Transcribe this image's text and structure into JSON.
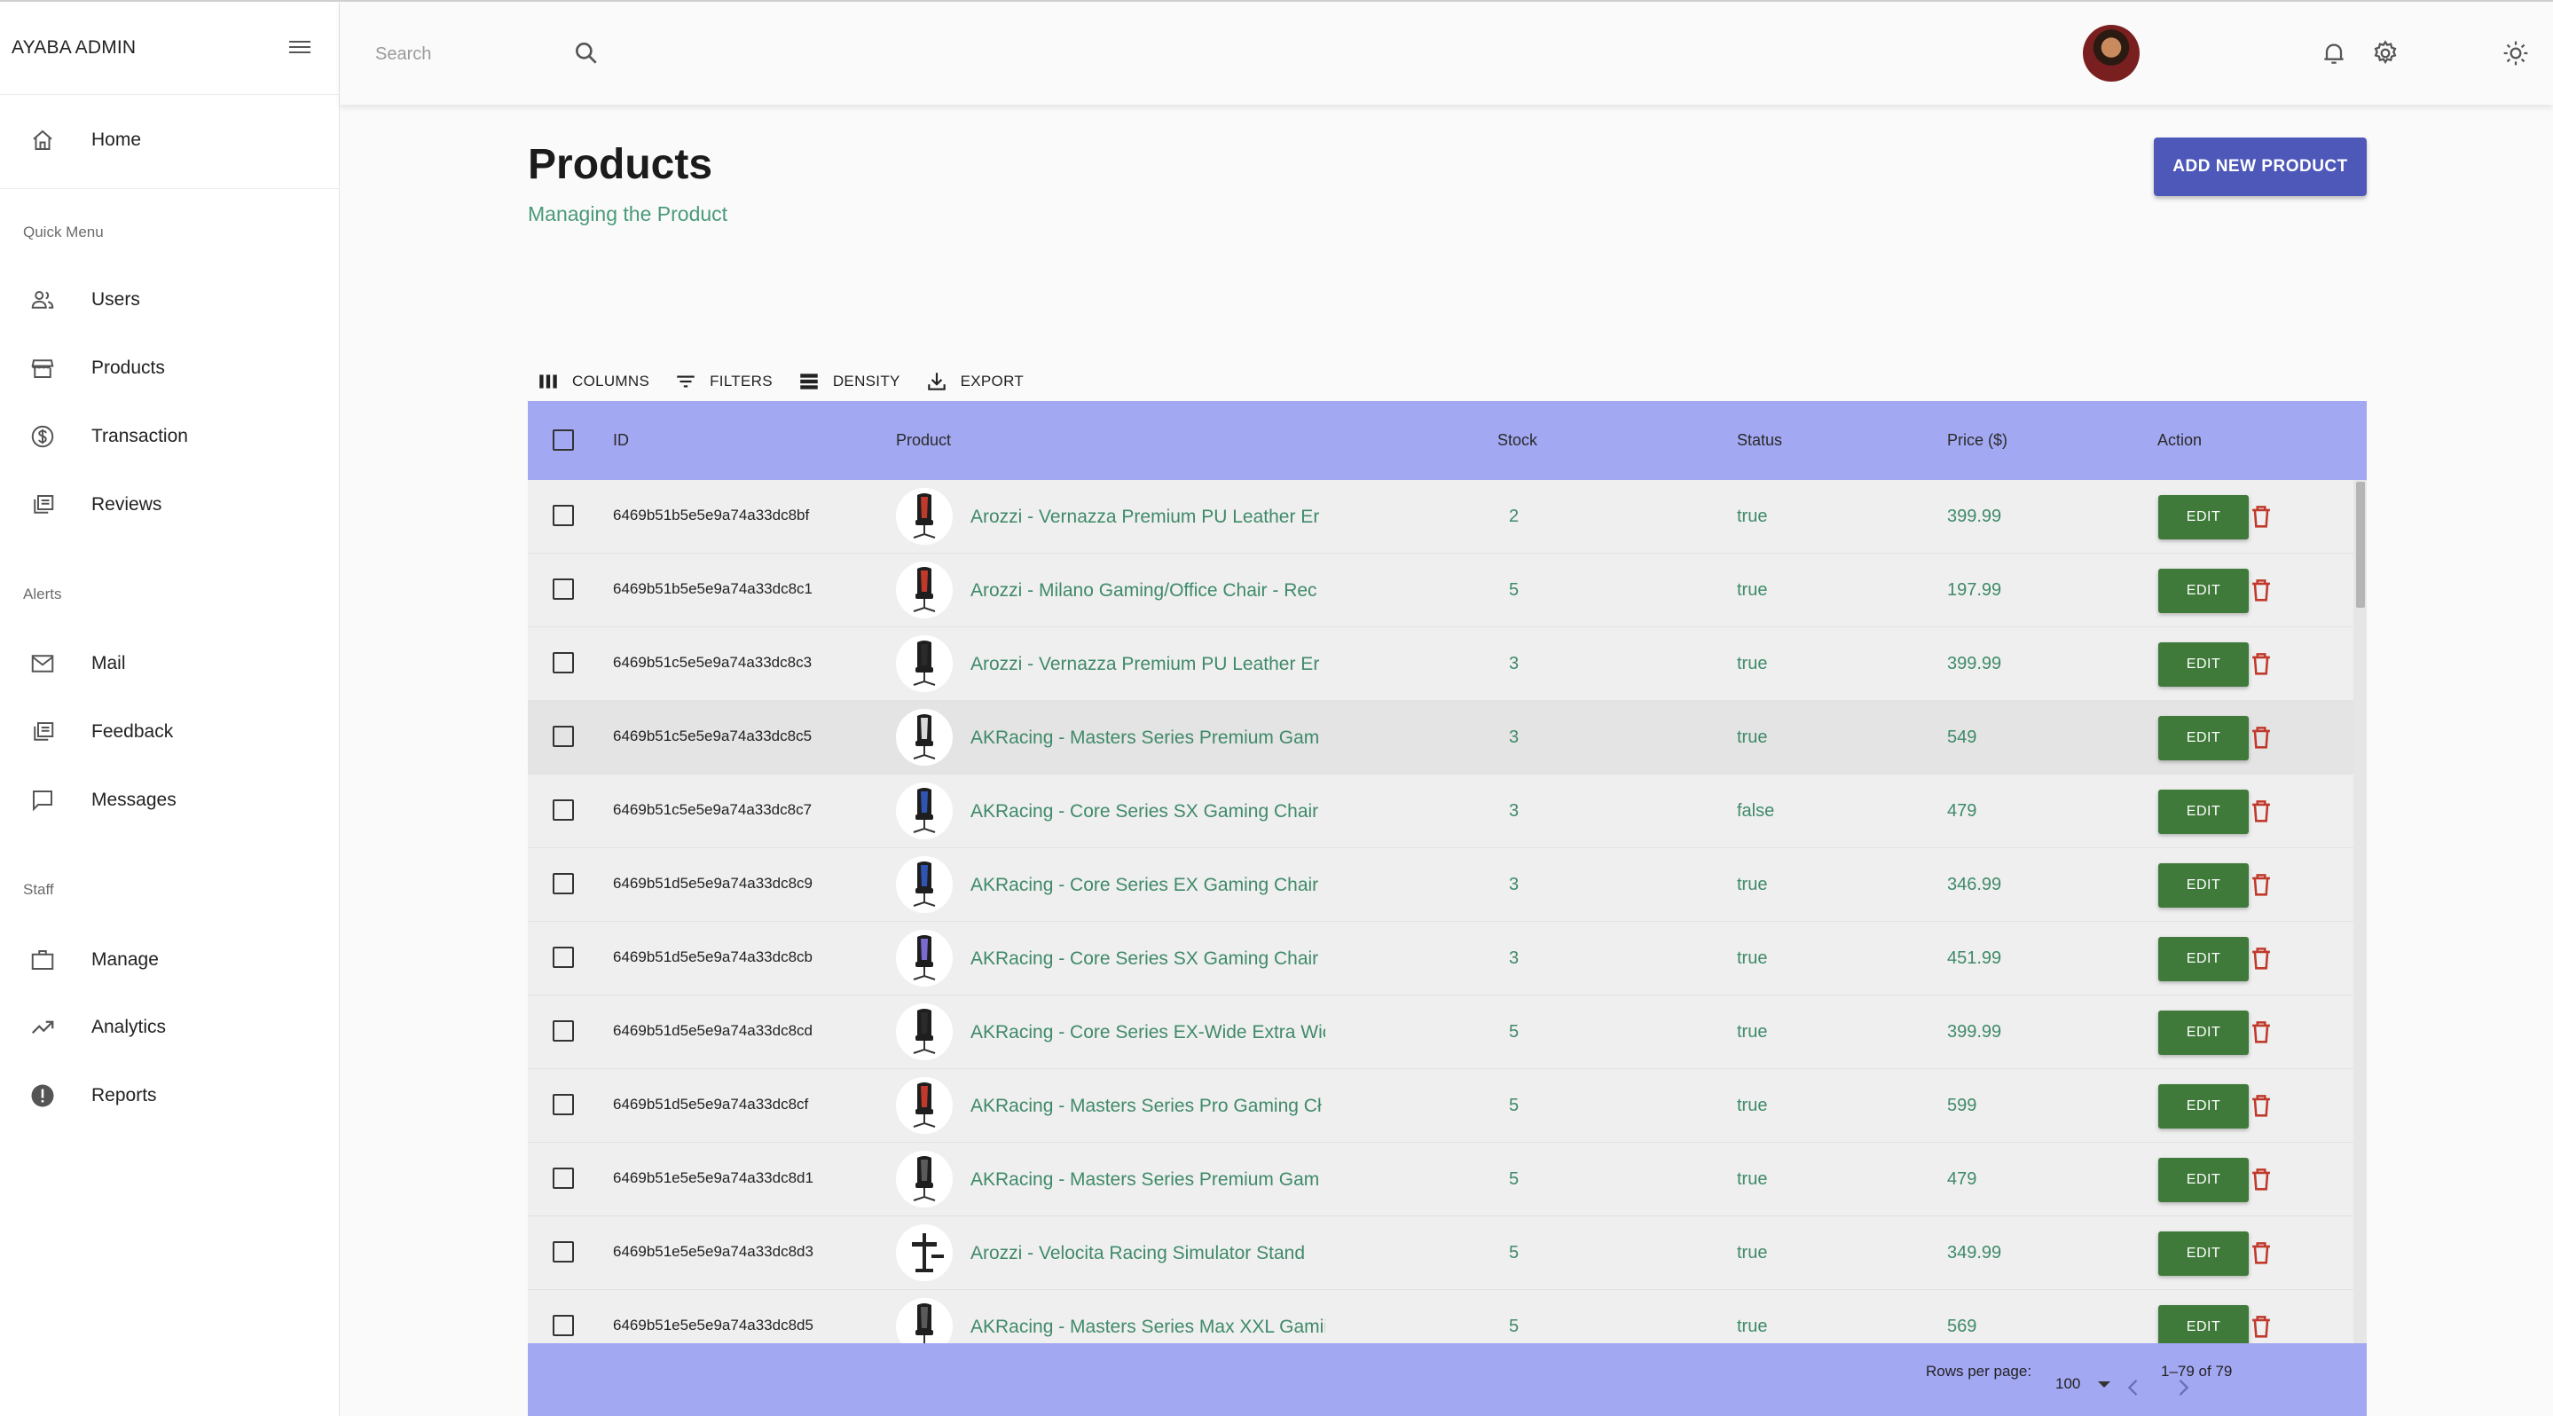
{
  "app": {
    "title": "AYABA ADMIN"
  },
  "sidebar": {
    "main": [
      {
        "label": "Home",
        "icon": "home-icon"
      }
    ],
    "sections": [
      {
        "title": "Quick Menu",
        "items": [
          {
            "label": "Users",
            "icon": "users-icon"
          },
          {
            "label": "Products",
            "icon": "store-icon"
          },
          {
            "label": "Transaction",
            "icon": "dollar-icon"
          },
          {
            "label": "Reviews",
            "icon": "library-icon"
          }
        ]
      },
      {
        "title": "Alerts",
        "items": [
          {
            "label": "Mail",
            "icon": "mail-icon"
          },
          {
            "label": "Feedback",
            "icon": "library-icon"
          },
          {
            "label": "Messages",
            "icon": "chat-icon"
          }
        ]
      },
      {
        "title": "Staff",
        "items": [
          {
            "label": "Manage",
            "icon": "briefcase-icon"
          },
          {
            "label": "Analytics",
            "icon": "trending-icon"
          },
          {
            "label": "Reports",
            "icon": "error-icon"
          }
        ]
      }
    ]
  },
  "topbar": {
    "search_placeholder": "Search",
    "icons": [
      "bell-icon",
      "gear-icon",
      "avatar",
      "sun-icon"
    ]
  },
  "page": {
    "title": "Products",
    "subtitle": "Managing the Product",
    "add_button": "ADD NEW PRODUCT"
  },
  "toolbar": {
    "columns": "COLUMNS",
    "filters": "FILTERS",
    "density": "DENSITY",
    "export": "EXPORT"
  },
  "table": {
    "columns": [
      "ID",
      "Product",
      "Stock",
      "Status",
      "Price ($)",
      "Action"
    ],
    "edit_label": "EDIT",
    "rows": [
      {
        "id": "6469b51b5e5e9a74a33dc8bf",
        "product": "Arozzi - Vernazza Premium PU Leather Er",
        "stock": "2",
        "status": "true",
        "price": "399.99",
        "chair": "red"
      },
      {
        "id": "6469b51b5e5e9a74a33dc8c1",
        "product": "Arozzi - Milano Gaming/Office Chair - Rec",
        "stock": "5",
        "status": "true",
        "price": "197.99",
        "chair": "red"
      },
      {
        "id": "6469b51c5e5e9a74a33dc8c3",
        "product": "Arozzi - Vernazza Premium PU Leather Er",
        "stock": "3",
        "status": "true",
        "price": "399.99",
        "chair": "black"
      },
      {
        "id": "6469b51c5e5e9a74a33dc8c5",
        "product": "AKRacing - Masters Series Premium Gam",
        "stock": "3",
        "status": "true",
        "price": "549",
        "chair": "white"
      },
      {
        "id": "6469b51c5e5e9a74a33dc8c7",
        "product": "AKRacing - Core Series SX Gaming Chair",
        "stock": "3",
        "status": "false",
        "price": "479",
        "chair": "blue"
      },
      {
        "id": "6469b51d5e5e9a74a33dc8c9",
        "product": "AKRacing - Core Series EX Gaming Chair",
        "stock": "3",
        "status": "true",
        "price": "346.99",
        "chair": "blue"
      },
      {
        "id": "6469b51d5e5e9a74a33dc8cb",
        "product": "AKRacing - Core Series SX Gaming Chair",
        "stock": "3",
        "status": "true",
        "price": "451.99",
        "chair": "purple"
      },
      {
        "id": "6469b51d5e5e9a74a33dc8cd",
        "product": "AKRacing - Core Series EX-Wide Extra Wic",
        "stock": "5",
        "status": "true",
        "price": "399.99",
        "chair": "black"
      },
      {
        "id": "6469b51d5e5e9a74a33dc8cf",
        "product": "AKRacing - Masters Series Pro Gaming Cł",
        "stock": "5",
        "status": "true",
        "price": "599",
        "chair": "red"
      },
      {
        "id": "6469b51e5e5e9a74a33dc8d1",
        "product": "AKRacing - Masters Series Premium Gam",
        "stock": "5",
        "status": "true",
        "price": "479",
        "chair": "gray"
      },
      {
        "id": "6469b51e5e5e9a74a33dc8d3",
        "product": "Arozzi - Velocita Racing Simulator Stand",
        "stock": "5",
        "status": "true",
        "price": "349.99",
        "chair": "stand"
      },
      {
        "id": "6469b51e5e5e9a74a33dc8d5",
        "product": "AKRacing - Masters Series Max XXL Gamii",
        "stock": "5",
        "status": "true",
        "price": "569",
        "chair": "gray"
      }
    ]
  },
  "footer": {
    "rows_per_page_label": "Rows per page:",
    "rows_per_page_value": "100",
    "range": "1–79 of 79"
  },
  "colors": {
    "accent": "#4e58b8",
    "table_header": "#a3a8f2",
    "green_text": "#3f8a69",
    "edit_button": "#3f7a3a",
    "delete": "#c0392b"
  }
}
